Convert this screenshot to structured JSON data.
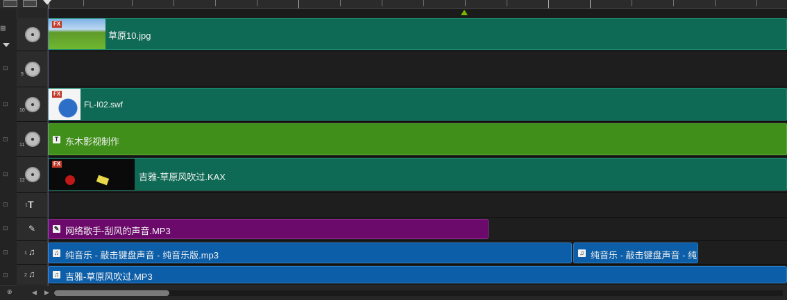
{
  "toolbar": {
    "zoom_label": "+/-"
  },
  "tracks": [
    {
      "num": "",
      "kind": "video",
      "clip_label": "草原10.jpg",
      "fx": "FX"
    },
    {
      "num": "9",
      "kind": "video"
    },
    {
      "num": "10",
      "kind": "video",
      "clip_label": "FL-I02.swf",
      "fx": "FX"
    },
    {
      "num": "11",
      "kind": "video",
      "clip_label": "东木影视制作",
      "badge": "T"
    },
    {
      "num": "12",
      "kind": "video",
      "clip_label": "吉雅-草原风吹过.KAX",
      "fx": "FX"
    },
    {
      "num": "1",
      "kind": "title"
    },
    {
      "num": "",
      "kind": "voice",
      "clip_label": "网络歌手-刮风的声音.MP3"
    },
    {
      "num": "1",
      "kind": "music",
      "clips": [
        "纯音乐 - 敲击键盘声音 - 纯音乐版.mp3",
        "纯音乐 - 敲击键盘声音 - 纯"
      ]
    },
    {
      "num": "2",
      "kind": "music",
      "clip_label": "吉雅-草原风吹过.MP3"
    }
  ],
  "colors": {
    "video_clip": "#0f6a55",
    "title_clip": "#3f8f1a",
    "voice_clip": "#6b0a6b",
    "music_clip": "#0c5ea8",
    "timeline_marker": "#7ab800"
  },
  "icons": [
    "film-reel-icon",
    "title-t-icon",
    "microphone-icon",
    "music-note-icon",
    "lock-icon",
    "scroll-left-icon",
    "scroll-right-icon"
  ]
}
